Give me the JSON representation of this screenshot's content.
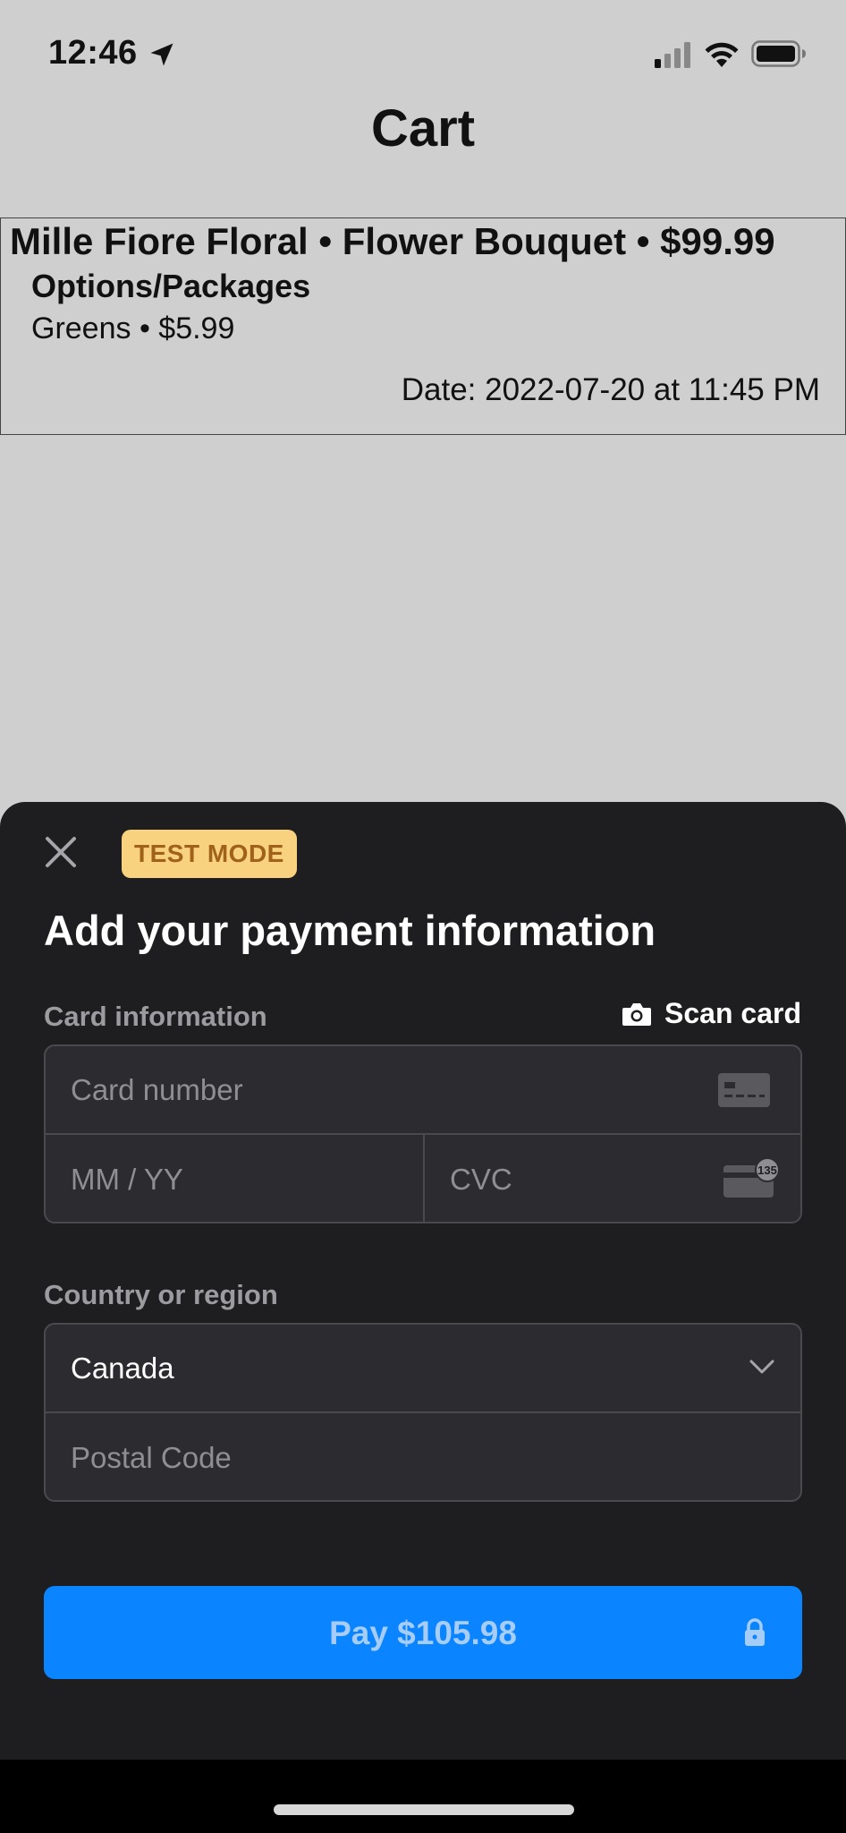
{
  "status_bar": {
    "time": "12:46"
  },
  "header": {
    "title": "Cart"
  },
  "cart_item": {
    "heading": "Mille Fiore Floral • Flower Bouquet • $99.99",
    "options_label": "Options/Packages",
    "option": "Greens • $5.99",
    "date": "Date: 2022-07-20 at 11:45 PM"
  },
  "sheet": {
    "badge": "TEST MODE",
    "title": "Add your payment information",
    "card_info_label": "Card information",
    "scan_card_label": "Scan card",
    "card_number_placeholder": "Card number",
    "expiry_placeholder": "MM / YY",
    "cvc_placeholder": "CVC",
    "cvc_icon_text": "135",
    "country_label": "Country or region",
    "country_value": "Canada",
    "postal_placeholder": "Postal Code",
    "pay_label": "Pay $105.98"
  },
  "colors": {
    "sheet_bg": "#1e1e20",
    "field_bg": "#2c2c30",
    "pay_button": "#0a84ff",
    "badge_bg": "#f8d27e",
    "badge_text": "#a0621a"
  },
  "icons": [
    "location-arrow-icon",
    "cellular-signal-icon",
    "wifi-icon",
    "battery-icon",
    "close-icon",
    "camera-icon",
    "card-brand-icon",
    "cvc-icon",
    "chevron-down-icon",
    "lock-icon"
  ]
}
